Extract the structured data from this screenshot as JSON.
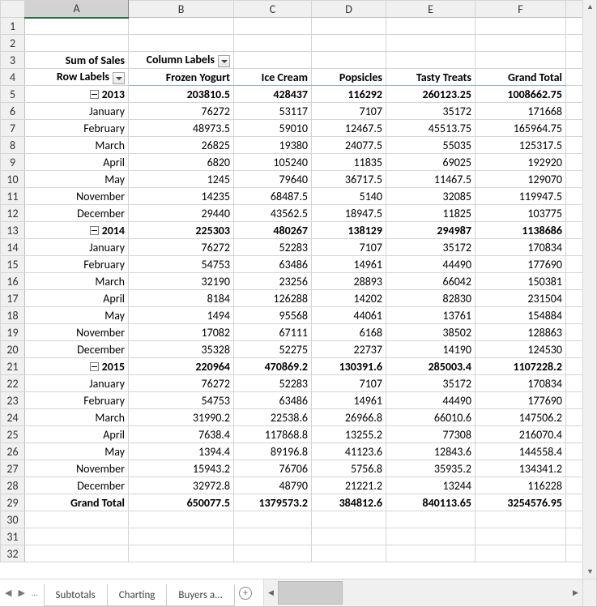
{
  "columns": [
    "A",
    "B",
    "C",
    "D",
    "E",
    "F"
  ],
  "pivot": {
    "title_cell": "Sum of Sales",
    "col_labels_cell": "Column Labels",
    "row_labels_cell": "Row Labels",
    "col_labels": [
      "Frozen Yogurt",
      "Ice Cream",
      "Popsicles",
      "Tasty Treats",
      "Grand Total"
    ],
    "years": [
      {
        "label": "2013",
        "totals": [
          "203810.5",
          "428437",
          "116292",
          "260123.25",
          "1008662.75"
        ],
        "months": [
          {
            "label": "January",
            "vals": [
              "76272",
              "53117",
              "7107",
              "35172",
              "171668"
            ]
          },
          {
            "label": "February",
            "vals": [
              "48973.5",
              "59010",
              "12467.5",
              "45513.75",
              "165964.75"
            ]
          },
          {
            "label": "March",
            "vals": [
              "26825",
              "19380",
              "24077.5",
              "55035",
              "125317.5"
            ]
          },
          {
            "label": "April",
            "vals": [
              "6820",
              "105240",
              "11835",
              "69025",
              "192920"
            ]
          },
          {
            "label": "May",
            "vals": [
              "1245",
              "79640",
              "36717.5",
              "11467.5",
              "129070"
            ]
          },
          {
            "label": "November",
            "vals": [
              "14235",
              "68487.5",
              "5140",
              "32085",
              "119947.5"
            ]
          },
          {
            "label": "December",
            "vals": [
              "29440",
              "43562.5",
              "18947.5",
              "11825",
              "103775"
            ]
          }
        ]
      },
      {
        "label": "2014",
        "totals": [
          "225303",
          "480267",
          "138129",
          "294987",
          "1138686"
        ],
        "months": [
          {
            "label": "January",
            "vals": [
              "76272",
              "52283",
              "7107",
              "35172",
              "170834"
            ]
          },
          {
            "label": "February",
            "vals": [
              "54753",
              "63486",
              "14961",
              "44490",
              "177690"
            ]
          },
          {
            "label": "March",
            "vals": [
              "32190",
              "23256",
              "28893",
              "66042",
              "150381"
            ]
          },
          {
            "label": "April",
            "vals": [
              "8184",
              "126288",
              "14202",
              "82830",
              "231504"
            ]
          },
          {
            "label": "May",
            "vals": [
              "1494",
              "95568",
              "44061",
              "13761",
              "154884"
            ]
          },
          {
            "label": "November",
            "vals": [
              "17082",
              "67111",
              "6168",
              "38502",
              "128863"
            ]
          },
          {
            "label": "December",
            "vals": [
              "35328",
              "52275",
              "22737",
              "14190",
              "124530"
            ]
          }
        ]
      },
      {
        "label": "2015",
        "totals": [
          "220964",
          "470869.2",
          "130391.6",
          "285003.4",
          "1107228.2"
        ],
        "months": [
          {
            "label": "January",
            "vals": [
              "76272",
              "52283",
              "7107",
              "35172",
              "170834"
            ]
          },
          {
            "label": "February",
            "vals": [
              "54753",
              "63486",
              "14961",
              "44490",
              "177690"
            ]
          },
          {
            "label": "March",
            "vals": [
              "31990.2",
              "22538.6",
              "26966.8",
              "66010.6",
              "147506.2"
            ]
          },
          {
            "label": "April",
            "vals": [
              "7638.4",
              "117868.8",
              "13255.2",
              "77308",
              "216070.4"
            ]
          },
          {
            "label": "May",
            "vals": [
              "1394.4",
              "89196.8",
              "41123.6",
              "12843.6",
              "144558.4"
            ]
          },
          {
            "label": "November",
            "vals": [
              "15943.2",
              "76706",
              "5756.8",
              "35935.2",
              "134341.2"
            ]
          },
          {
            "label": "December",
            "vals": [
              "32972.8",
              "48790",
              "21221.2",
              "13244",
              "116228"
            ]
          }
        ]
      }
    ],
    "grand_total_label": "Grand Total",
    "grand_totals": [
      "650077.5",
      "1379573.2",
      "384812.6",
      "840113.65",
      "3254576.95"
    ]
  },
  "tabs": {
    "visible": [
      "Subtotals",
      "Charting",
      "Buyers a..."
    ]
  },
  "row_start": 1,
  "row_end": 32
}
